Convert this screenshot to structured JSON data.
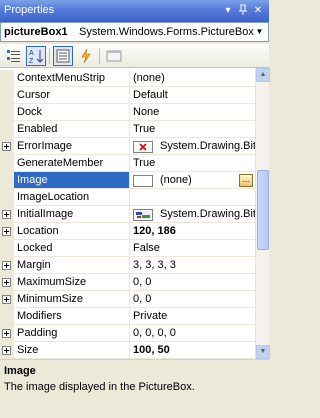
{
  "window": {
    "title": "Properties"
  },
  "object_selector": {
    "name": "pictureBox1",
    "type": "System.Windows.Forms.PictureBox"
  },
  "properties": [
    {
      "name": "ContextMenuStrip",
      "value": "(none)",
      "expandable": false
    },
    {
      "name": "Cursor",
      "value": "Default",
      "expandable": false
    },
    {
      "name": "Dock",
      "value": "None",
      "expandable": false
    },
    {
      "name": "Enabled",
      "value": "True",
      "expandable": false
    },
    {
      "name": "ErrorImage",
      "value": "System.Drawing.Bit",
      "expandable": true,
      "icon": "error-image-icon"
    },
    {
      "name": "GenerateMember",
      "value": "True",
      "expandable": false
    },
    {
      "name": "Image",
      "value": "(none)",
      "expandable": false,
      "selected": true
    },
    {
      "name": "ImageLocation",
      "value": "",
      "expandable": false
    },
    {
      "name": "InitialImage",
      "value": "System.Drawing.Bit",
      "expandable": true,
      "icon": "initial-image-icon"
    },
    {
      "name": "Location",
      "value": "120, 186",
      "expandable": true,
      "bold": true
    },
    {
      "name": "Locked",
      "value": "False",
      "expandable": false
    },
    {
      "name": "Margin",
      "value": "3, 3, 3, 3",
      "expandable": true
    },
    {
      "name": "MaximumSize",
      "value": "0, 0",
      "expandable": true
    },
    {
      "name": "MinimumSize",
      "value": "0, 0",
      "expandable": true
    },
    {
      "name": "Modifiers",
      "value": "Private",
      "expandable": false
    },
    {
      "name": "Padding",
      "value": "0, 0, 0, 0",
      "expandable": true
    },
    {
      "name": "Size",
      "value": "100, 50",
      "expandable": true,
      "bold": true
    }
  ],
  "description": {
    "title": "Image",
    "text": "The image displayed in the PictureBox."
  }
}
